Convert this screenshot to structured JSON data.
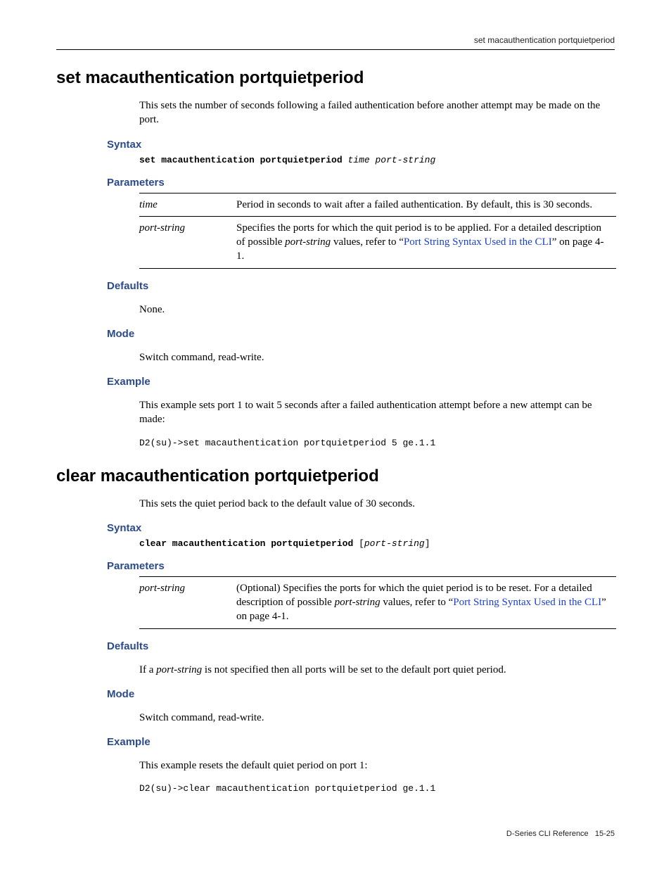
{
  "running_head": "set macauthentication portquietperiod",
  "cmd1": {
    "title": "set macauthentication portquietperiod",
    "intro": "This sets the number of seconds following a failed authentication before another attempt may be made on the port.",
    "syntax_label": "Syntax",
    "syntax_cmd": "set macauthentication portquietperiod",
    "syntax_args": "time port-string",
    "params_label": "Parameters",
    "params": [
      {
        "name": "time",
        "desc": "Period in seconds to wait after a failed authentication. By default, this is 30 seconds."
      },
      {
        "name": "port-string",
        "desc_pre": "Specifies the ports for which the quit period is to be applied. For a detailed description of possible ",
        "desc_var": "port-string",
        "desc_mid": " values, refer to “",
        "link": "Port String Syntax Used in the CLI",
        "desc_post": "” on page 4-1."
      }
    ],
    "defaults_label": "Defaults",
    "defaults_text": "None.",
    "mode_label": "Mode",
    "mode_text": "Switch command, read-write.",
    "example_label": "Example",
    "example_intro": "This example sets port 1 to wait 5 seconds after a failed authentication attempt before a new attempt can be made:",
    "example_code": "D2(su)->set macauthentication portquietperiod 5 ge.1.1"
  },
  "cmd2": {
    "title": "clear macauthentication portquietperiod",
    "intro": "This sets the quiet period back to the default value of 30 seconds.",
    "syntax_label": "Syntax",
    "syntax_cmd": "clear macauthentication portquietperiod",
    "syntax_args": "port-string",
    "params_label": "Parameters",
    "params": [
      {
        "name": "port-string",
        "desc_pre": "(Optional) Specifies the ports for which the quiet period is to be reset. For a detailed description of possible ",
        "desc_var": "port-string",
        "desc_mid": " values, refer to “",
        "link": "Port String Syntax Used in the CLI",
        "desc_post": "” on page 4-1."
      }
    ],
    "defaults_label": "Defaults",
    "defaults_pre": "If a ",
    "defaults_var": "port-string",
    "defaults_post": " is not specified then all ports will be set to the default port quiet period.",
    "mode_label": "Mode",
    "mode_text": "Switch command, read-write.",
    "example_label": "Example",
    "example_intro": "This example resets the default quiet period on port 1:",
    "example_code": "D2(su)->clear macauthentication portquietperiod ge.1.1"
  },
  "footer": {
    "doc": "D-Series CLI Reference",
    "page": "15-25"
  }
}
